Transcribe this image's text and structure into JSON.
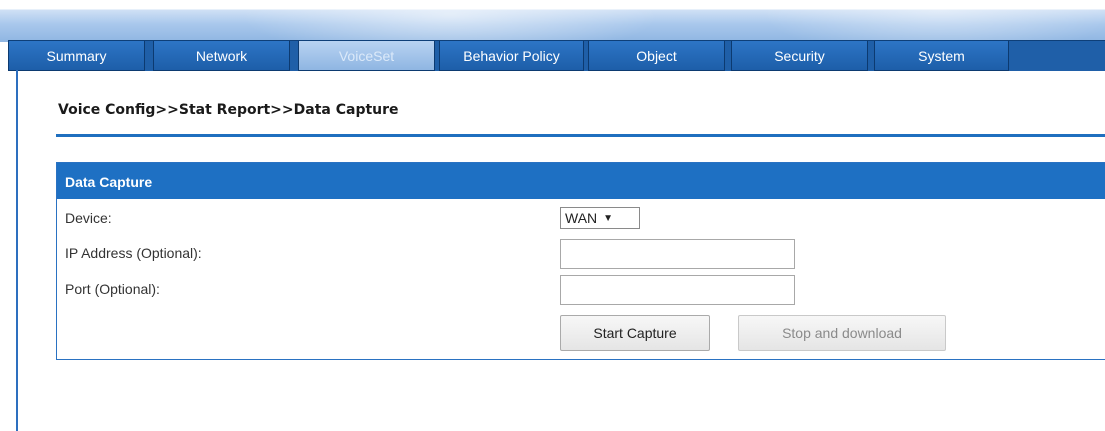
{
  "tabs": [
    {
      "label": "Summary"
    },
    {
      "label": "Network"
    },
    {
      "label": "VoiceSet",
      "active": true
    },
    {
      "label": "Behavior Policy"
    },
    {
      "label": "Object"
    },
    {
      "label": "Security"
    },
    {
      "label": "System"
    }
  ],
  "breadcrumb": "Voice Config>>Stat Report>>Data Capture",
  "panel": {
    "title": "Data Capture",
    "device_label": "Device:",
    "device_value": "WAN",
    "ip_label": "IP Address (Optional):",
    "ip_value": "",
    "port_label": "Port (Optional):",
    "port_value": "",
    "start_button": "Start Capture",
    "stop_button": "Stop and download"
  },
  "colors": {
    "tab_bar": "#1f5fa8",
    "panel_header": "#1e70c3",
    "accent_rule": "#1f6fbf"
  }
}
